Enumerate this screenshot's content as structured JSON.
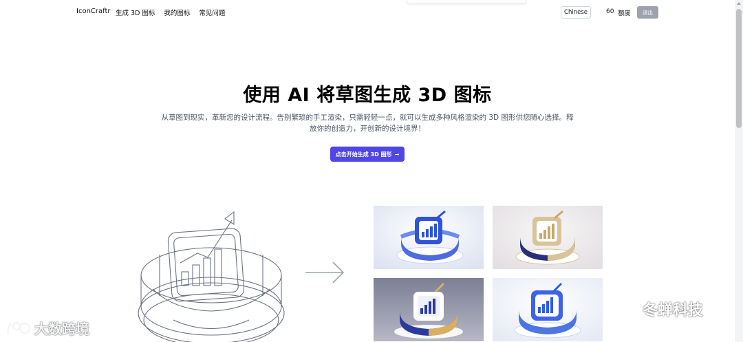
{
  "header": {
    "brand": "IconCraftr",
    "nav": [
      "生成 3D 图标",
      "我的图标",
      "常见问题"
    ],
    "language_button": "Chinese",
    "credits_value": "60",
    "credits_label": "额度",
    "logout_button": "退出"
  },
  "hero": {
    "title": "使用 AI 将草图生成 3D 图标",
    "subtitle": "从草图到现实，革新您的设计流程。告别繁琐的手工渲染，只需轻轻一点，就可以生成多种风格渲染的 3D 图形供您随心选择。释放你的创造力，开创新的设计境界！",
    "cta_label": "点击开始生成 3D 图形",
    "cta_icon": "arrow-right-icon"
  },
  "showcase": {
    "sketch_icon": "bar-chart-sketch",
    "transform_icon": "arrow-right-icon",
    "renders": [
      {
        "style": "blue-glass",
        "colors": [
          "#eef1f8",
          "#3b5bdb",
          "#ffffff"
        ]
      },
      {
        "style": "navy-gold",
        "colors": [
          "#ece9ec",
          "#2a2f7a",
          "#d9c49a"
        ]
      },
      {
        "style": "gold-dark",
        "colors": [
          "#5a5f7a",
          "#2b3a9b",
          "#d8b060"
        ]
      },
      {
        "style": "blue-white",
        "colors": [
          "#f3f5fb",
          "#2f5de0",
          "#ffffff"
        ]
      }
    ]
  },
  "watermarks": {
    "left": "大数跨境",
    "right": "冬蝉科技"
  }
}
